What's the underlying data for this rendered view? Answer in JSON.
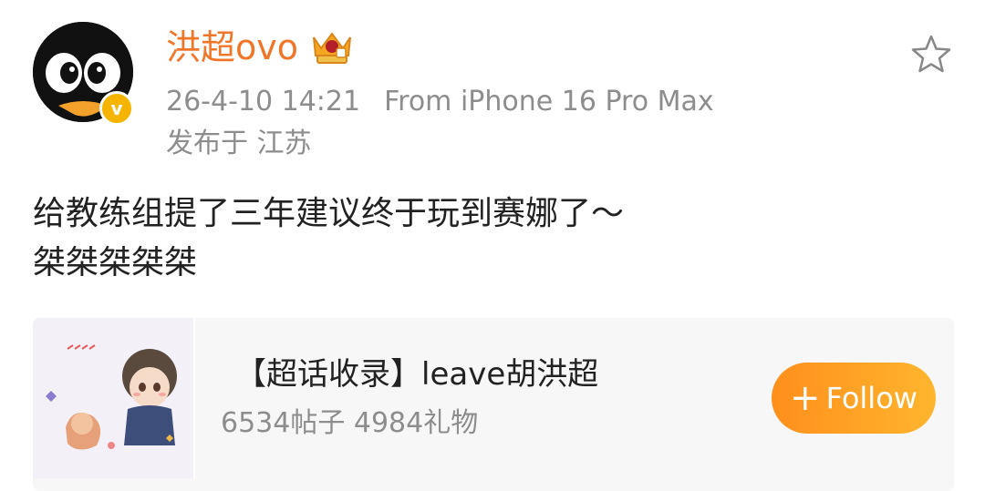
{
  "post": {
    "username": "洪超ovo",
    "datetime": "26-4-10 14:21",
    "device": "From iPhone 16 Pro Max",
    "location": "发布于 江苏",
    "text_line1": "给教练组提了三年建议终于玩到赛娜了～",
    "text_line2": "桀桀桀桀桀"
  },
  "card": {
    "title": "【超话收录】leave胡洪超",
    "stats": "6534帖子 4984礼物",
    "follow_plus": "+",
    "follow_label": "Follow"
  },
  "colors": {
    "username": "#f0762a",
    "verified_badge": "#f5b400",
    "follow_button": "#ff9f24",
    "meta_text": "#8d8d8d"
  },
  "icons": [
    "avatar-penguin",
    "verified-icon",
    "crown-badge-icon",
    "star-icon",
    "plus-icon",
    "supertopic-thumbnail"
  ]
}
